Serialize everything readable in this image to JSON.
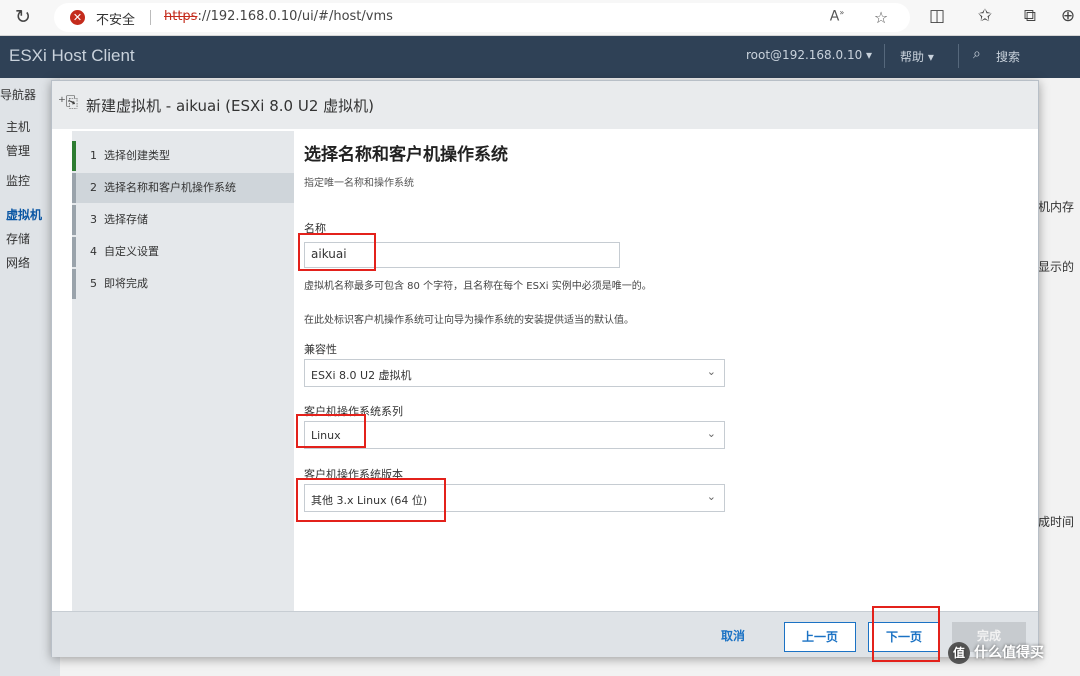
{
  "browser": {
    "security_label": "不安全",
    "url_scheme": "https",
    "url_rest": "://192.168.0.10/ui/#/host/vms"
  },
  "header": {
    "app_title": "ESXi Host Client",
    "user": "root@192.168.0.10 ▾",
    "help": "帮助 ▾",
    "search": "搜索"
  },
  "left_nav": {
    "items": [
      "导航器",
      "主机",
      "管理",
      "监控",
      "虚拟机",
      "存储",
      "网络"
    ]
  },
  "background": {
    "col_memory": "机内存",
    "col_show": "显示的",
    "col_time": "成时间"
  },
  "modal": {
    "title": "新建虚拟机 - aikuai (ESXi 8.0 U2 虚拟机)",
    "steps": [
      {
        "num": "1",
        "label": "选择创建类型"
      },
      {
        "num": "2",
        "label": "选择名称和客户机操作系统"
      },
      {
        "num": "3",
        "label": "选择存储"
      },
      {
        "num": "4",
        "label": "自定义设置"
      },
      {
        "num": "5",
        "label": "即将完成"
      }
    ],
    "content": {
      "title": "选择名称和客户机操作系统",
      "subtitle": "指定唯一名称和操作系统",
      "name_label": "名称",
      "name_value": "aikuai",
      "name_hint": "虚拟机名称最多可包含 80 个字符，且名称在每个 ESXi 实例中必须是唯一的。",
      "os_hint": "在此处标识客户机操作系统可让向导为操作系统的安装提供适当的默认值。",
      "compat_label": "兼容性",
      "compat_value": "ESXi 8.0 U2 虚拟机",
      "family_label": "客户机操作系统系列",
      "family_value": "Linux",
      "version_label": "客户机操作系统版本",
      "version_value": "其他 3.x Linux (64 位)"
    },
    "footer": {
      "cancel": "取消",
      "back": "上一页",
      "next": "下一页",
      "finish": "完成"
    }
  },
  "watermark": {
    "text": "什么值得买",
    "logo": "值"
  }
}
